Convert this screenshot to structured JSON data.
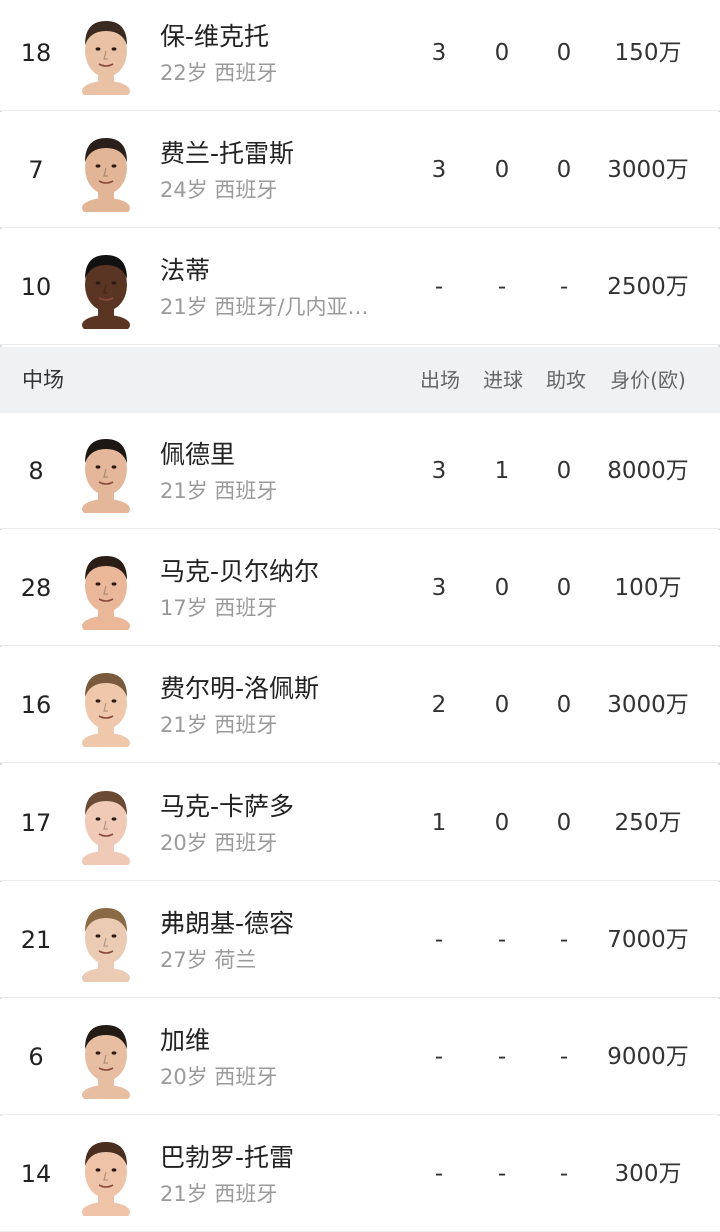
{
  "forwards_tail": [
    {
      "number": "18",
      "name": "保-维克托",
      "info": "22岁 西班牙",
      "apps": "3",
      "goals": "0",
      "assists": "0",
      "value": "150万",
      "skin": "#e9c2a6",
      "hair": "#3a2a20"
    },
    {
      "number": "7",
      "name": "费兰-托雷斯",
      "info": "24岁 西班牙",
      "apps": "3",
      "goals": "0",
      "assists": "0",
      "value": "3000万",
      "skin": "#e2b597",
      "hair": "#2a1f1a"
    },
    {
      "number": "10",
      "name": "法蒂",
      "info": "21岁 西班牙/几内亚…",
      "apps": "-",
      "goals": "-",
      "assists": "-",
      "value": "2500万",
      "skin": "#5a3523",
      "hair": "#111111"
    }
  ],
  "midfield_section": {
    "title": "中场",
    "columns": [
      "出场",
      "进球",
      "助攻",
      "身价(欧)"
    ]
  },
  "midfielders": [
    {
      "number": "8",
      "name": "佩德里",
      "info": "21岁 西班牙",
      "apps": "3",
      "goals": "1",
      "assists": "0",
      "value": "8000万",
      "skin": "#e4b79a",
      "hair": "#1d1713"
    },
    {
      "number": "28",
      "name": "马克-贝尔纳尔",
      "info": "17岁 西班牙",
      "apps": "3",
      "goals": "0",
      "assists": "0",
      "value": "100万",
      "skin": "#eab899",
      "hair": "#2b1e17"
    },
    {
      "number": "16",
      "name": "费尔明-洛佩斯",
      "info": "21岁 西班牙",
      "apps": "2",
      "goals": "0",
      "assists": "0",
      "value": "3000万",
      "skin": "#efc8ac",
      "hair": "#7a5a3c"
    },
    {
      "number": "17",
      "name": "马克-卡萨多",
      "info": "20岁 西班牙",
      "apps": "1",
      "goals": "0",
      "assists": "0",
      "value": "250万",
      "skin": "#f0c9b7",
      "hair": "#6b4a34"
    },
    {
      "number": "21",
      "name": "弗朗基-德容",
      "info": "27岁 荷兰",
      "apps": "-",
      "goals": "-",
      "assists": "-",
      "value": "7000万",
      "skin": "#eccbb4",
      "hair": "#8a6a45"
    },
    {
      "number": "6",
      "name": "加维",
      "info": "20岁 西班牙",
      "apps": "-",
      "goals": "-",
      "assists": "-",
      "value": "9000万",
      "skin": "#e8bea3",
      "hair": "#251b15"
    },
    {
      "number": "14",
      "name": "巴勃罗-托雷",
      "info": "21岁 西班牙",
      "apps": "-",
      "goals": "-",
      "assists": "-",
      "value": "300万",
      "skin": "#efc3a8",
      "hair": "#4a2e20"
    }
  ]
}
